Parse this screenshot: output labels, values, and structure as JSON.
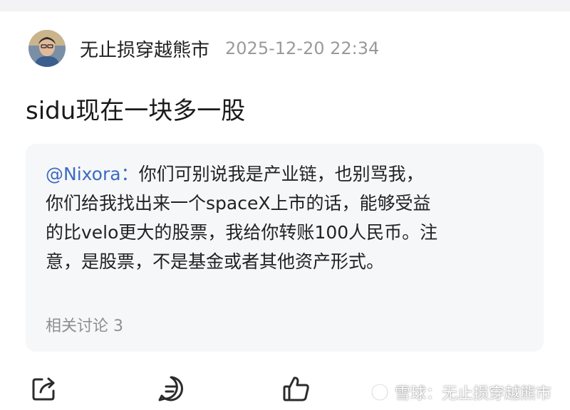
{
  "post": {
    "author": "无止损穿越熊市",
    "timestamp": "2025-12-20 22:34",
    "text": "sidu现在一块多一股"
  },
  "quote": {
    "mention": "@Nixora",
    "separator": "：",
    "line1_rest": "你们可别说我是产业链，也别骂我，",
    "line2": "你们给我找出来一个spaceX上市的话，能够受益",
    "line3": "的比velo更大的股票，我给你转账100人民币。注",
    "line4": "意，是股票，不是基金或者其他资产形式。",
    "related": "相关讨论 3"
  },
  "actions": {
    "icons": [
      "share-icon",
      "comment-icon",
      "like-icon"
    ]
  },
  "watermark": {
    "text": "雪球：无止损穿越熊市"
  },
  "colors": {
    "mention": "#3d6bbf",
    "timestamp": "#9a9a9a",
    "card_bg": "#f6f7f9",
    "icon": "#2b2b2b"
  }
}
